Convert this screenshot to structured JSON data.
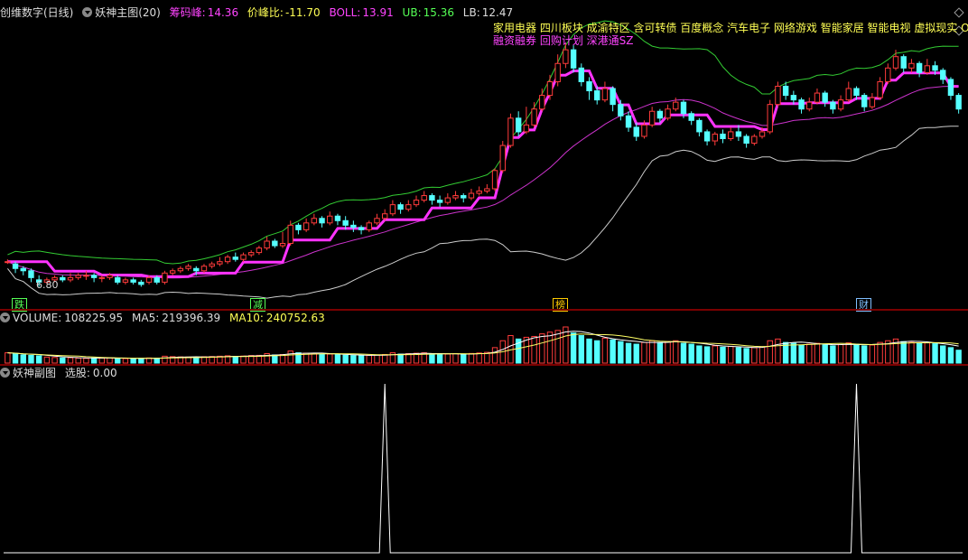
{
  "main_header": {
    "title": "创维数字(日线)",
    "indicator": "妖神主图(20)",
    "chouma_label": "筹码峰:",
    "chouma_value": "14.36",
    "jiafeng_label": "价峰比:",
    "jiafeng_value": "-11.70",
    "boll_label": "BOLL:",
    "boll_value": "13.91",
    "ub_label": "UB:",
    "ub_value": "15.36",
    "lb_label": "LB:",
    "lb_value": "12.47"
  },
  "concepts": {
    "line1": "家用电器  四川板块  成渝特区 含可转债 百度概念 汽车电子 网络游戏 智能家居 智能电视 虚拟现实 O",
    "line2": "融资融券 回购计划 深港通SZ"
  },
  "signals": [
    {
      "label": "跌",
      "color": "#55ff55"
    },
    {
      "label": "减",
      "color": "#55ff55"
    },
    {
      "label": "榜",
      "color": "#ffcc00"
    },
    {
      "label": "财",
      "color": "#7fbfff"
    }
  ],
  "low_label": "6.80",
  "volume_header": {
    "label": "VOLUME:",
    "value": "108225.95",
    "ma5_label": "MA5:",
    "ma5_value": "219396.39",
    "ma10_label": "MA10:",
    "ma10_value": "240752.63"
  },
  "sub_header": {
    "label": "妖神副图",
    "select_label": "选股:",
    "select_value": "0.00"
  },
  "colors": {
    "up": "#ff3b3b",
    "down": "#55ffff",
    "ma_pink": "#ff33ff",
    "boll_upper": "#33cc33",
    "boll_mid": "#cc33cc",
    "boll_lower": "#cccccc",
    "vol_ma5": "#ffffff",
    "vol_ma10": "#ffff66"
  },
  "chart_data": {
    "type": "candlestick",
    "price_range": [
      6.5,
      17.8
    ],
    "candles": [
      [
        7.9,
        7.9,
        8.0,
        7.8
      ],
      [
        7.8,
        7.6,
        7.9,
        7.4
      ],
      [
        7.6,
        7.5,
        7.7,
        7.3
      ],
      [
        7.5,
        7.2,
        7.6,
        7.0
      ],
      [
        7.1,
        7.0,
        7.3,
        6.8
      ],
      [
        7.0,
        7.1,
        7.2,
        6.9
      ],
      [
        7.1,
        7.2,
        7.3,
        7.0
      ],
      [
        7.2,
        7.1,
        7.3,
        7.0
      ],
      [
        7.1,
        7.2,
        7.4,
        7.0
      ],
      [
        7.2,
        7.3,
        7.4,
        7.1
      ],
      [
        7.3,
        7.3,
        7.5,
        7.1
      ],
      [
        7.3,
        7.2,
        7.4,
        7.0
      ],
      [
        7.2,
        7.2,
        7.3,
        7.0
      ],
      [
        7.2,
        7.3,
        7.4,
        7.1
      ],
      [
        7.2,
        7.0,
        7.3,
        6.9
      ],
      [
        7.0,
        7.1,
        7.2,
        6.9
      ],
      [
        7.1,
        7.0,
        7.2,
        6.9
      ],
      [
        7.0,
        6.9,
        7.1,
        6.8
      ],
      [
        7.0,
        7.2,
        7.3,
        6.9
      ],
      [
        7.2,
        7.0,
        7.3,
        6.9
      ],
      [
        7.0,
        7.4,
        7.5,
        6.9
      ],
      [
        7.4,
        7.5,
        7.6,
        7.3
      ],
      [
        7.5,
        7.6,
        7.7,
        7.4
      ],
      [
        7.6,
        7.7,
        7.8,
        7.5
      ],
      [
        7.6,
        7.5,
        7.7,
        7.3
      ],
      [
        7.5,
        7.7,
        7.8,
        7.4
      ],
      [
        7.7,
        7.8,
        7.9,
        7.6
      ],
      [
        7.8,
        7.9,
        8.1,
        7.7
      ],
      [
        7.9,
        8.1,
        8.2,
        7.8
      ],
      [
        8.1,
        8.0,
        8.3,
        7.9
      ],
      [
        8.0,
        8.2,
        8.3,
        7.9
      ],
      [
        8.2,
        8.3,
        8.4,
        8.1
      ],
      [
        8.3,
        8.5,
        8.6,
        8.2
      ],
      [
        8.5,
        8.8,
        9.0,
        8.4
      ],
      [
        8.8,
        8.6,
        8.9,
        8.5
      ],
      [
        8.6,
        8.7,
        9.2,
        8.5
      ],
      [
        8.7,
        9.5,
        9.7,
        8.6
      ],
      [
        9.5,
        9.3,
        9.6,
        9.1
      ],
      [
        9.3,
        9.6,
        9.8,
        9.2
      ],
      [
        9.6,
        9.8,
        10.0,
        9.5
      ],
      [
        9.8,
        9.6,
        9.9,
        9.4
      ],
      [
        9.6,
        9.9,
        10.1,
        9.5
      ],
      [
        9.9,
        9.7,
        10.0,
        9.5
      ],
      [
        9.7,
        9.5,
        9.9,
        9.3
      ],
      [
        9.5,
        9.4,
        9.7,
        9.2
      ],
      [
        9.4,
        9.3,
        9.5,
        9.1
      ],
      [
        9.3,
        9.6,
        9.7,
        9.2
      ],
      [
        9.6,
        9.8,
        10.0,
        9.5
      ],
      [
        9.8,
        10.0,
        10.2,
        9.7
      ],
      [
        10.0,
        10.4,
        10.6,
        9.9
      ],
      [
        10.4,
        10.2,
        10.5,
        10.0
      ],
      [
        10.2,
        10.4,
        10.6,
        10.1
      ],
      [
        10.4,
        10.6,
        10.8,
        10.3
      ],
      [
        10.6,
        10.8,
        11.0,
        10.5
      ],
      [
        10.8,
        10.6,
        10.9,
        10.4
      ],
      [
        10.6,
        10.5,
        10.8,
        10.3
      ],
      [
        10.5,
        10.7,
        10.9,
        10.4
      ],
      [
        10.7,
        10.8,
        11.0,
        10.6
      ],
      [
        10.8,
        10.7,
        10.9,
        10.5
      ],
      [
        10.7,
        10.9,
        11.1,
        10.6
      ],
      [
        10.9,
        11.0,
        11.2,
        10.8
      ],
      [
        11.0,
        11.1,
        11.3,
        10.9
      ],
      [
        11.1,
        11.9,
        12.0,
        11.0
      ],
      [
        11.9,
        13.0,
        13.2,
        11.8
      ],
      [
        13.0,
        14.2,
        14.4,
        12.9
      ],
      [
        14.2,
        13.6,
        14.5,
        13.4
      ],
      [
        13.6,
        13.9,
        14.7,
        13.5
      ],
      [
        13.9,
        14.6,
        14.9,
        13.8
      ],
      [
        14.6,
        15.2,
        15.5,
        14.5
      ],
      [
        15.2,
        15.8,
        16.1,
        15.0
      ],
      [
        15.8,
        16.6,
        17.0,
        15.6
      ],
      [
        16.6,
        17.2,
        17.5,
        16.4
      ],
      [
        17.2,
        16.4,
        17.4,
        16.2
      ],
      [
        16.4,
        15.8,
        16.6,
        15.6
      ],
      [
        15.8,
        15.4,
        16.0,
        15.0
      ],
      [
        15.4,
        15.0,
        15.6,
        14.8
      ],
      [
        15.0,
        15.5,
        15.8,
        14.9
      ],
      [
        15.5,
        14.8,
        15.6,
        14.5
      ],
      [
        14.8,
        14.3,
        15.0,
        14.1
      ],
      [
        14.3,
        13.8,
        14.5,
        13.6
      ],
      [
        13.8,
        13.4,
        14.0,
        13.2
      ],
      [
        13.4,
        13.9,
        14.1,
        13.3
      ],
      [
        13.9,
        14.5,
        14.7,
        13.8
      ],
      [
        14.5,
        14.2,
        14.6,
        14.0
      ],
      [
        14.2,
        14.6,
        14.8,
        14.1
      ],
      [
        14.6,
        14.9,
        15.1,
        14.5
      ],
      [
        14.9,
        14.4,
        15.0,
        14.2
      ],
      [
        14.4,
        14.1,
        14.5,
        13.9
      ],
      [
        14.1,
        13.6,
        14.2,
        13.4
      ],
      [
        13.6,
        13.2,
        13.7,
        13.0
      ],
      [
        13.2,
        13.5,
        13.6,
        13.0
      ],
      [
        13.5,
        13.3,
        13.7,
        13.1
      ],
      [
        13.3,
        13.6,
        13.8,
        13.2
      ],
      [
        13.6,
        13.4,
        13.9,
        13.2
      ],
      [
        13.4,
        13.1,
        13.5,
        12.9
      ],
      [
        13.1,
        13.4,
        13.5,
        13.0
      ],
      [
        13.4,
        13.6,
        13.8,
        13.3
      ],
      [
        13.6,
        14.8,
        15.0,
        13.5
      ],
      [
        14.8,
        15.6,
        15.8,
        14.7
      ],
      [
        15.6,
        15.2,
        15.8,
        15.0
      ],
      [
        15.2,
        15.0,
        15.4,
        14.8
      ],
      [
        15.0,
        14.6,
        15.1,
        14.4
      ],
      [
        14.6,
        14.9,
        15.1,
        14.5
      ],
      [
        14.9,
        15.3,
        15.5,
        14.8
      ],
      [
        15.3,
        14.9,
        15.4,
        14.7
      ],
      [
        14.9,
        14.6,
        15.0,
        14.4
      ],
      [
        14.6,
        15.0,
        15.2,
        14.5
      ],
      [
        15.0,
        15.5,
        15.8,
        14.9
      ],
      [
        15.5,
        15.2,
        15.6,
        15.0
      ],
      [
        15.2,
        14.7,
        15.3,
        14.5
      ],
      [
        14.7,
        15.1,
        15.3,
        14.6
      ],
      [
        15.1,
        15.8,
        16.0,
        15.0
      ],
      [
        15.8,
        16.4,
        16.6,
        15.7
      ],
      [
        16.4,
        16.9,
        17.2,
        16.3
      ],
      [
        16.9,
        16.4,
        17.0,
        16.2
      ],
      [
        16.4,
        16.6,
        16.8,
        16.2
      ],
      [
        16.6,
        16.2,
        16.7,
        16.0
      ],
      [
        16.2,
        16.5,
        16.8,
        16.1
      ],
      [
        16.5,
        16.3,
        16.7,
        16.1
      ],
      [
        16.3,
        15.9,
        16.4,
        15.7
      ],
      [
        15.9,
        15.2,
        16.0,
        15.0
      ],
      [
        15.2,
        14.6,
        15.3,
        14.4
      ]
    ],
    "volume": [
      120,
      110,
      95,
      90,
      85,
      70,
      65,
      60,
      62,
      58,
      55,
      60,
      58,
      62,
      55,
      52,
      50,
      54,
      60,
      58,
      80,
      75,
      72,
      70,
      68,
      74,
      76,
      80,
      85,
      78,
      82,
      88,
      90,
      110,
      95,
      100,
      140,
      120,
      115,
      110,
      100,
      105,
      98,
      92,
      88,
      85,
      90,
      95,
      100,
      120,
      105,
      110,
      115,
      120,
      108,
      100,
      105,
      110,
      100,
      112,
      118,
      125,
      180,
      260,
      320,
      280,
      300,
      310,
      340,
      360,
      380,
      420,
      350,
      320,
      280,
      260,
      290,
      270,
      250,
      230,
      220,
      240,
      260,
      240,
      250,
      260,
      230,
      220,
      200,
      190,
      200,
      185,
      195,
      180,
      170,
      180,
      190,
      260,
      280,
      240,
      230,
      210,
      220,
      230,
      210,
      200,
      215,
      235,
      220,
      200,
      210,
      240,
      260,
      280,
      250,
      240,
      230,
      235,
      225,
      200,
      180,
      150
    ],
    "signal_spikes": [
      48,
      108
    ]
  }
}
